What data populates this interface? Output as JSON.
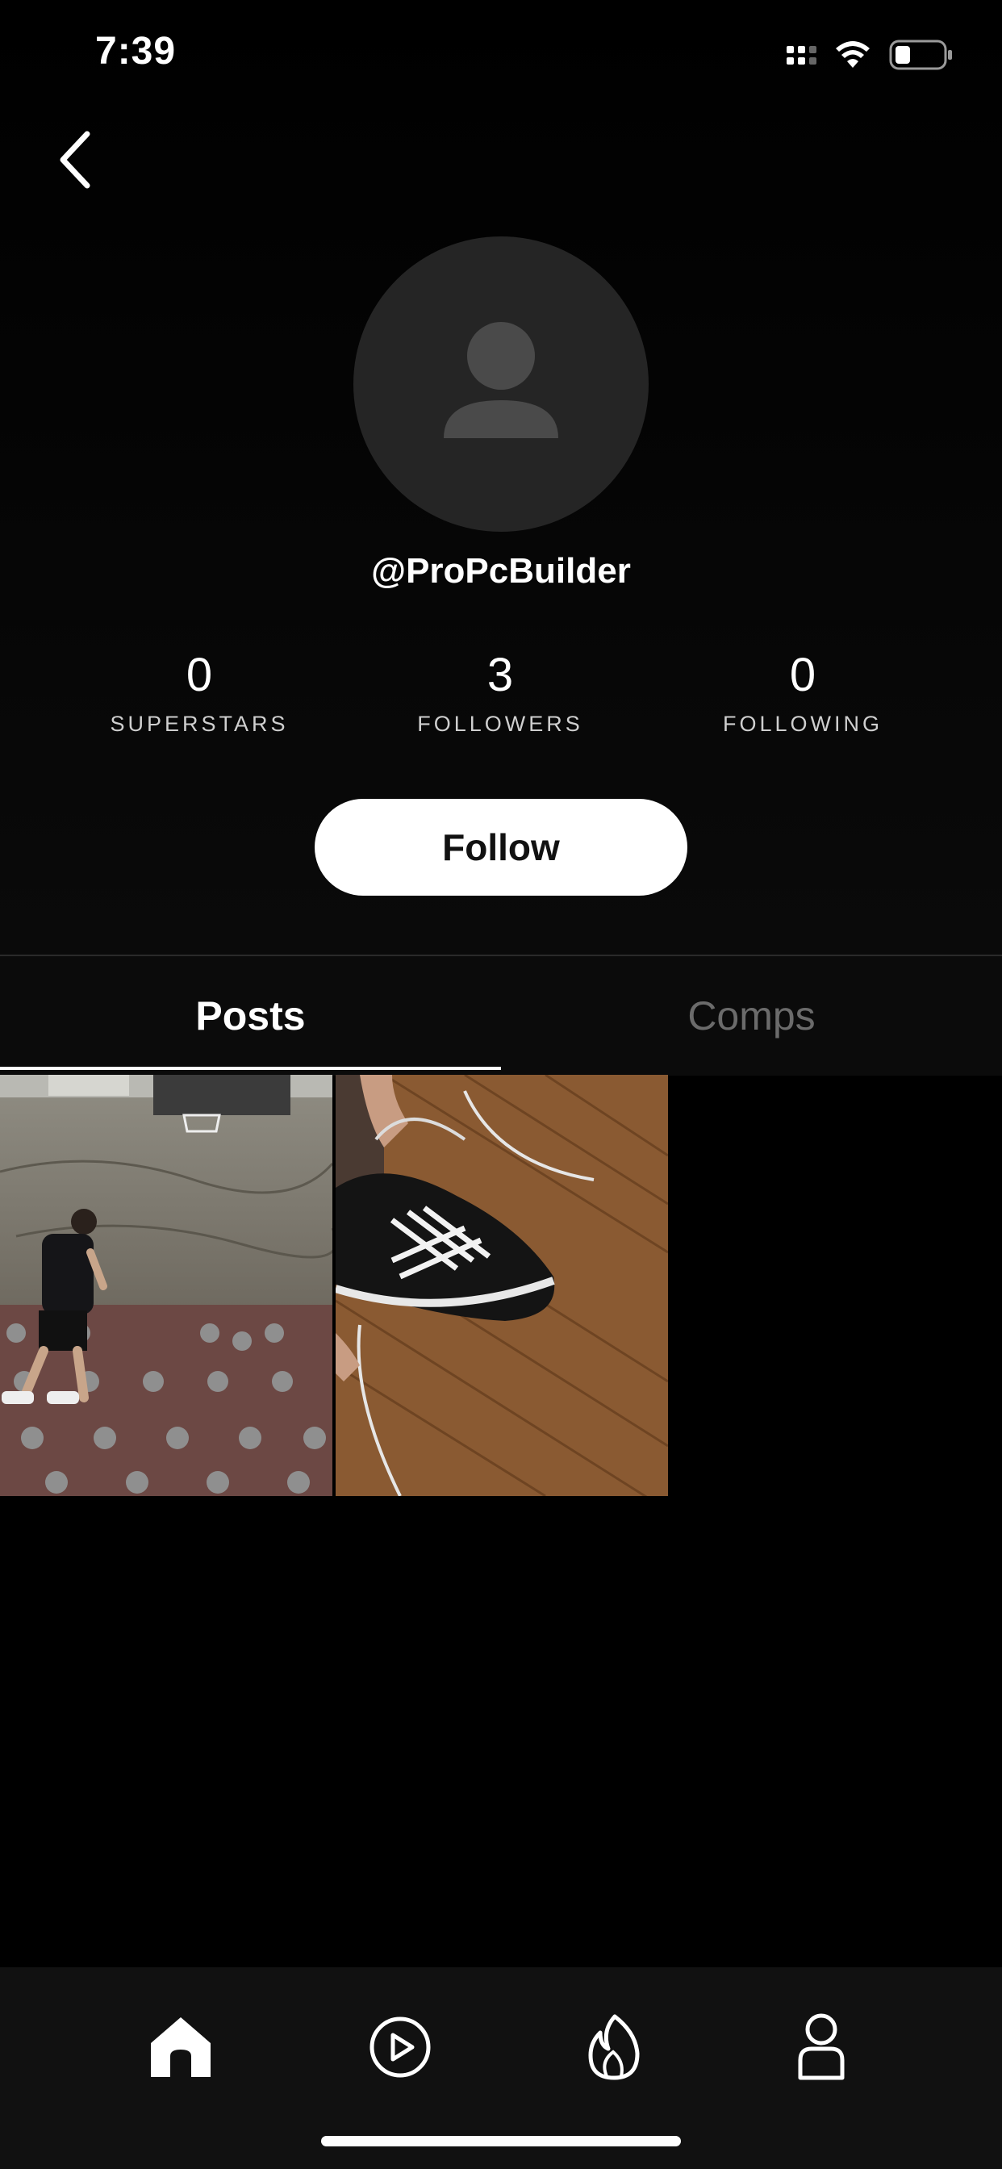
{
  "status_bar": {
    "time": "7:39",
    "icons": [
      "cellular-signal-icon",
      "wifi-icon",
      "battery-icon"
    ]
  },
  "header": {
    "back_icon": "chevron-left-icon"
  },
  "profile": {
    "avatar_icon": "default-user-icon",
    "username": "@ProPcBuilder",
    "stats": [
      {
        "value": "0",
        "label": "SUPERSTARS"
      },
      {
        "value": "3",
        "label": "FOLLOWERS"
      },
      {
        "value": "0",
        "label": "FOLLOWING"
      }
    ],
    "follow_label": "Follow"
  },
  "tabs": [
    {
      "label": "Posts",
      "active": true
    },
    {
      "label": "Comps",
      "active": false
    }
  ],
  "posts": [
    {
      "id": "post-basketball",
      "icon": "video-thumbnail"
    },
    {
      "id": "post-shoelace",
      "icon": "video-thumbnail"
    }
  ],
  "bottom_nav": [
    {
      "name": "home-icon",
      "active": true
    },
    {
      "name": "play-circle-icon",
      "active": false
    },
    {
      "name": "flame-icon",
      "active": false
    },
    {
      "name": "profile-icon",
      "active": false
    }
  ],
  "colors": {
    "background": "#000000",
    "avatar_bg": "#252525",
    "tab_inactive": "#6b6b6b",
    "follow_button": "#ffffff",
    "tabbar_bg": "#111111"
  }
}
